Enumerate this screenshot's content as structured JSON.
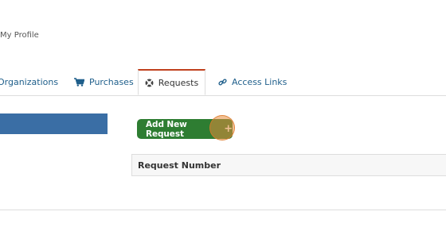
{
  "breadcrumb": {
    "current": "My Profile"
  },
  "tabs": [
    {
      "label": "Organizations",
      "icon": "none",
      "active": false
    },
    {
      "label": "Purchases",
      "icon": "shopping-cart-icon",
      "active": false
    },
    {
      "label": "Requests",
      "icon": "life-ring-icon",
      "active": true
    },
    {
      "label": "Access Links",
      "icon": "link-icon",
      "active": false
    }
  ],
  "actions": {
    "add_request_label": "Add New Request",
    "add_icon": "+"
  },
  "table": {
    "columns": [
      "Request Number"
    ]
  },
  "colors": {
    "link": "#1f5f8b",
    "active_tab_accent": "#c0401e",
    "primary_button": "#2e7d32",
    "side_block": "#3a6ea5"
  }
}
